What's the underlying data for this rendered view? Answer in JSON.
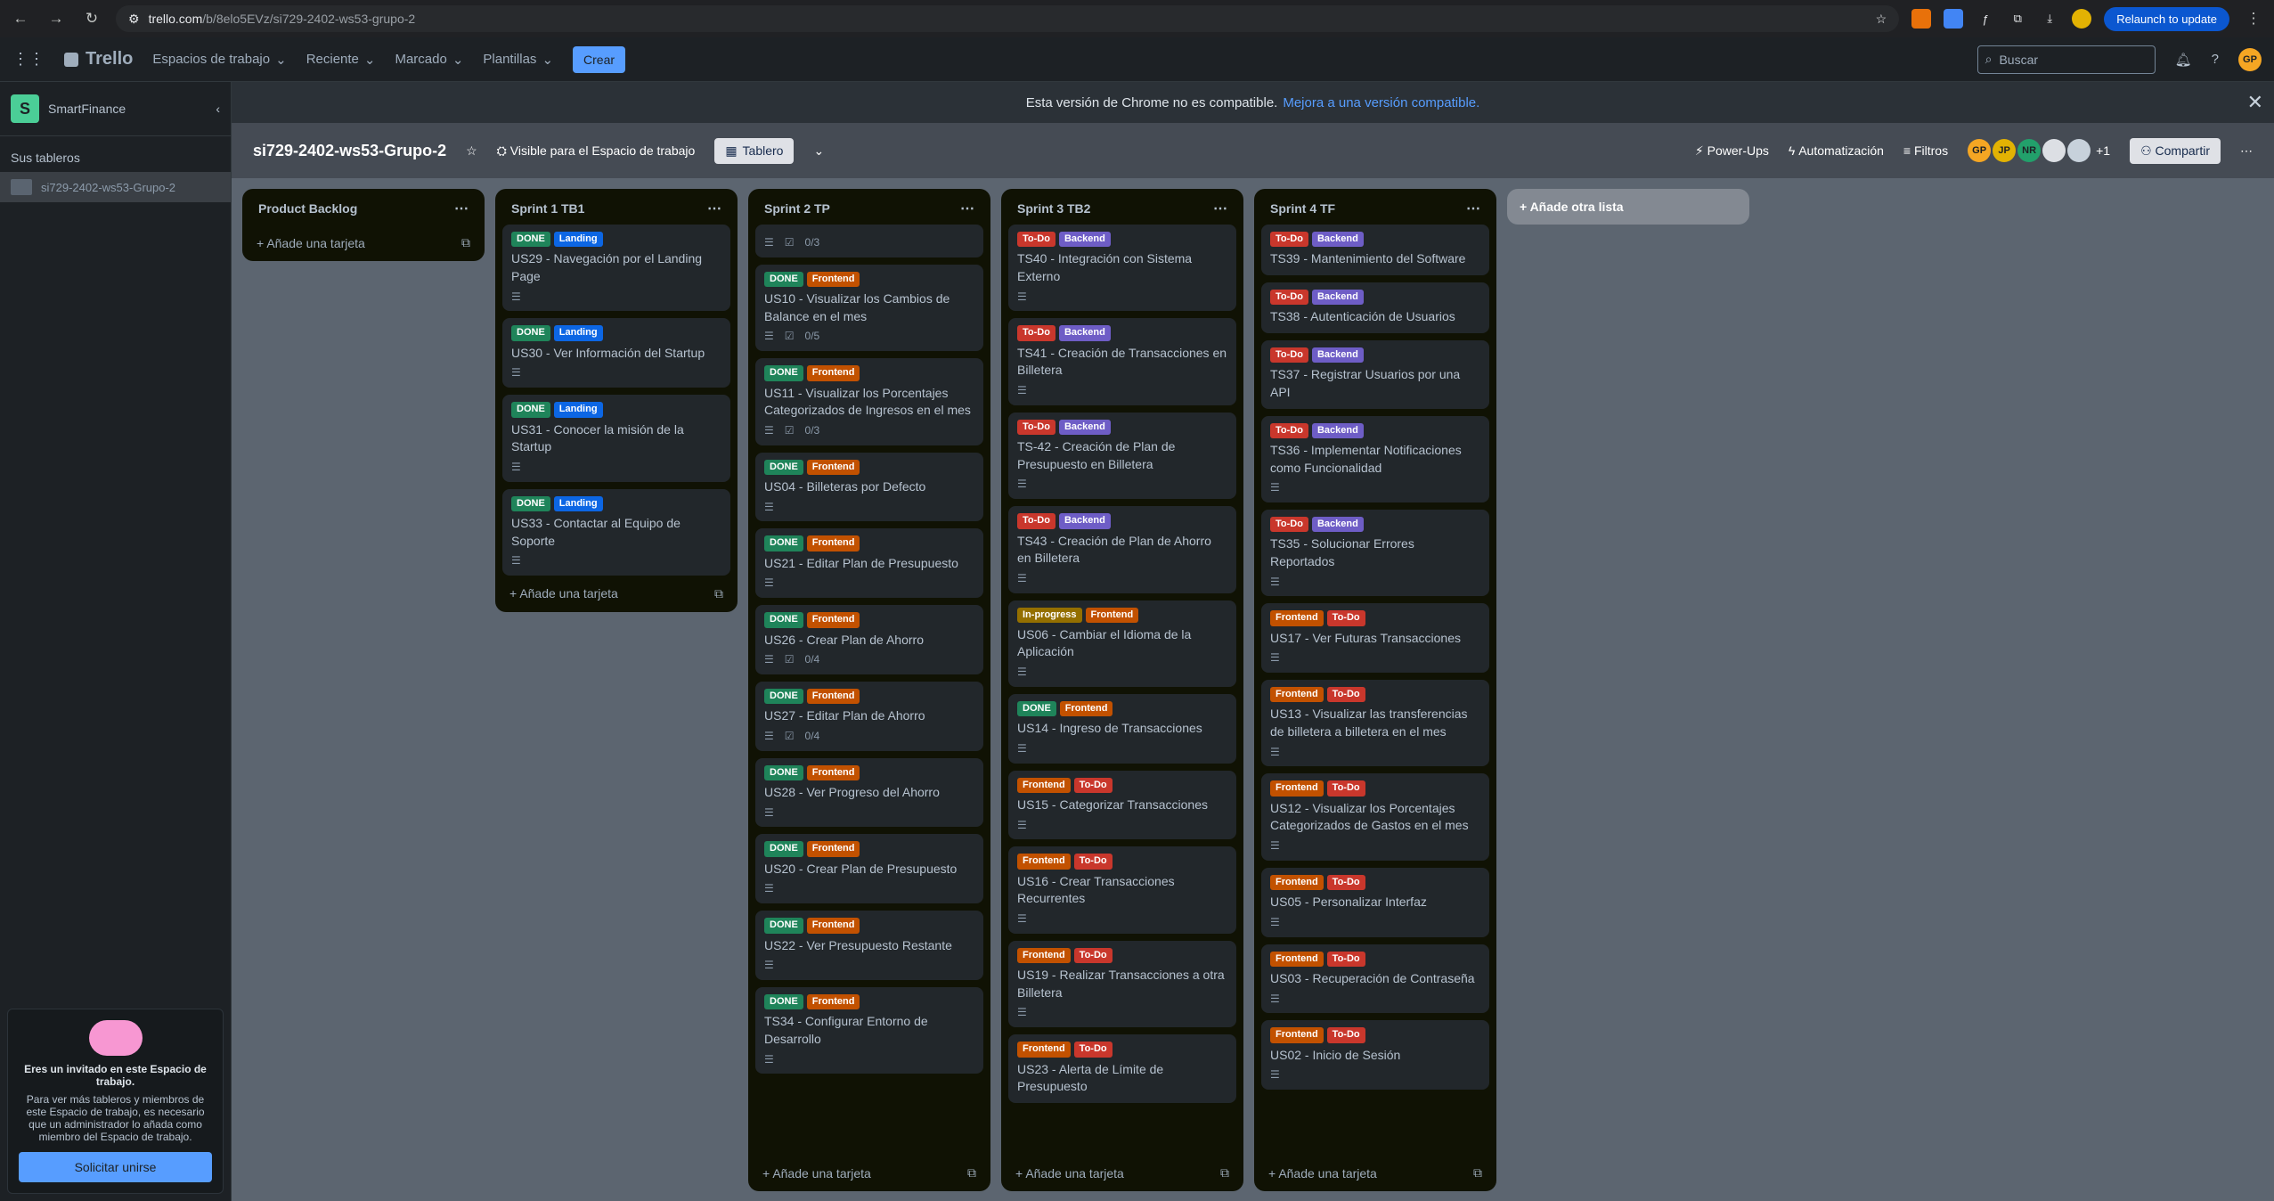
{
  "browser": {
    "url_domain": "trello.com",
    "url_path": "/b/8elo5EVz/si729-2402-ws53-grupo-2",
    "relaunch": "Relaunch to update",
    "avatar": "GP"
  },
  "nav": {
    "brand": "Trello",
    "menus": [
      "Espacios de trabajo",
      "Reciente",
      "Marcado",
      "Plantillas"
    ],
    "create": "Crear",
    "search_placeholder": "Buscar",
    "avatar": "GP"
  },
  "sidebar": {
    "workspace": "SmartFinance",
    "ws_initial": "S",
    "section": "Sus tableros",
    "board": "si729-2402-ws53-Grupo-2",
    "invite": {
      "title": "Eres un invitado en este Espacio de trabajo.",
      "text": "Para ver más tableros y miembros de este Espacio de trabajo, es necesario que un administrador lo añada como miembro del Espacio de trabajo.",
      "button": "Solicitar unirse"
    }
  },
  "banner": {
    "text": "Esta versión de Chrome no es compatible.",
    "link": "Mejora a una versión compatible."
  },
  "board": {
    "title": "si729-2402-ws53-Grupo-2",
    "visibility": "Visible para el Espacio de trabajo",
    "view": "Tablero",
    "powerups": "Power-Ups",
    "automation": "Automatización",
    "filters": "Filtros",
    "members": [
      "GP",
      "JP",
      "NR"
    ],
    "extra_members": "+1",
    "share": "Compartir"
  },
  "colors": {
    "DONE": "#1f845a",
    "Landing": "#0c66e4",
    "Frontend": "#c25100",
    "Backend": "#6e5dc6",
    "To-Do": "#c9372c",
    "In-progress": "#946f00"
  },
  "add_card": "Añade una tarjeta",
  "add_list": "Añade otra lista",
  "lists": [
    {
      "name": "Product Backlog",
      "cards": []
    },
    {
      "name": "Sprint 1 TB1",
      "cards": [
        {
          "labels": [
            "DONE",
            "Landing"
          ],
          "title": "US29 - Navegación por el Landing Page",
          "desc": true
        },
        {
          "labels": [
            "DONE",
            "Landing"
          ],
          "title": "US30 - Ver Información del Startup",
          "desc": true
        },
        {
          "labels": [
            "DONE",
            "Landing"
          ],
          "title": "US31 - Conocer la misión de la Startup",
          "desc": true
        },
        {
          "labels": [
            "DONE",
            "Landing"
          ],
          "title": "US33 - Contactar al Equipo de Soporte",
          "desc": true
        }
      ]
    },
    {
      "name": "Sprint 2 TP",
      "cards": [
        {
          "labels": [],
          "title": "",
          "desc": true,
          "check": "0/3"
        },
        {
          "labels": [
            "DONE",
            "Frontend"
          ],
          "title": "US10 - Visualizar los Cambios de Balance en el mes",
          "desc": true,
          "check": "0/5"
        },
        {
          "labels": [
            "DONE",
            "Frontend"
          ],
          "title": "US11 - Visualizar los Porcentajes Categorizados de Ingresos en el mes",
          "desc": true,
          "check": "0/3"
        },
        {
          "labels": [
            "DONE",
            "Frontend"
          ],
          "title": "US04 - Billeteras por Defecto",
          "desc": true
        },
        {
          "labels": [
            "DONE",
            "Frontend"
          ],
          "title": "US21 - Editar Plan de Presupuesto",
          "desc": true
        },
        {
          "labels": [
            "DONE",
            "Frontend"
          ],
          "title": "US26 - Crear Plan de Ahorro",
          "desc": true,
          "check": "0/4"
        },
        {
          "labels": [
            "DONE",
            "Frontend"
          ],
          "title": "US27 - Editar Plan de Ahorro",
          "desc": true,
          "check": "0/4"
        },
        {
          "labels": [
            "DONE",
            "Frontend"
          ],
          "title": "US28 - Ver Progreso del Ahorro",
          "desc": true
        },
        {
          "labels": [
            "DONE",
            "Frontend"
          ],
          "title": "US20 - Crear Plan de Presupuesto",
          "desc": true
        },
        {
          "labels": [
            "DONE",
            "Frontend"
          ],
          "title": "US22 - Ver Presupuesto Restante",
          "desc": true
        },
        {
          "labels": [
            "DONE",
            "Frontend"
          ],
          "title": "TS34 - Configurar Entorno de Desarrollo",
          "desc": true
        }
      ]
    },
    {
      "name": "Sprint 3 TB2",
      "cards": [
        {
          "labels": [
            "To-Do",
            "Backend"
          ],
          "title": "TS40 - Integración con Sistema Externo",
          "desc": true
        },
        {
          "labels": [
            "To-Do",
            "Backend"
          ],
          "title": "TS41 - Creación de Transacciones en Billetera",
          "desc": true
        },
        {
          "labels": [
            "To-Do",
            "Backend"
          ],
          "title": "TS-42 - Creación de Plan de Presupuesto en Billetera",
          "desc": true
        },
        {
          "labels": [
            "To-Do",
            "Backend"
          ],
          "title": "TS43 - Creación de Plan de Ahorro en Billetera",
          "desc": true
        },
        {
          "labels": [
            "In-progress",
            "Frontend"
          ],
          "title": "US06 - Cambiar el Idioma de la Aplicación",
          "desc": true
        },
        {
          "labels": [
            "DONE",
            "Frontend"
          ],
          "title": "US14 - Ingreso de Transacciones",
          "desc": true
        },
        {
          "labels": [
            "Frontend",
            "To-Do"
          ],
          "title": "US15 - Categorizar Transacciones",
          "desc": true
        },
        {
          "labels": [
            "Frontend",
            "To-Do"
          ],
          "title": "US16 - Crear Transacciones Recurrentes",
          "desc": true
        },
        {
          "labels": [
            "Frontend",
            "To-Do"
          ],
          "title": "US19 - Realizar Transacciones a otra Billetera",
          "desc": true
        },
        {
          "labels": [
            "Frontend",
            "To-Do"
          ],
          "title": "US23 - Alerta de Límite de Presupuesto",
          "desc": false
        }
      ]
    },
    {
      "name": "Sprint 4 TF",
      "cards": [
        {
          "labels": [
            "To-Do",
            "Backend"
          ],
          "title": "TS39 - Mantenimiento del Software",
          "desc": false
        },
        {
          "labels": [
            "To-Do",
            "Backend"
          ],
          "title": "TS38 - Autenticación de Usuarios",
          "desc": false
        },
        {
          "labels": [
            "To-Do",
            "Backend"
          ],
          "title": "TS37 - Registrar Usuarios por una API",
          "desc": false
        },
        {
          "labels": [
            "To-Do",
            "Backend"
          ],
          "title": "TS36 - Implementar Notificaciones como Funcionalidad",
          "desc": true
        },
        {
          "labels": [
            "To-Do",
            "Backend"
          ],
          "title": "TS35 - Solucionar Errores Reportados",
          "desc": true
        },
        {
          "labels": [
            "Frontend",
            "To-Do"
          ],
          "title": "US17 - Ver Futuras Transacciones",
          "desc": true
        },
        {
          "labels": [
            "Frontend",
            "To-Do"
          ],
          "title": "US13 - Visualizar las transferencias de billetera a billetera en el mes",
          "desc": true
        },
        {
          "labels": [
            "Frontend",
            "To-Do"
          ],
          "title": "US12 - Visualizar los Porcentajes Categorizados de Gastos en el mes",
          "desc": true
        },
        {
          "labels": [
            "Frontend",
            "To-Do"
          ],
          "title": "US05 - Personalizar Interfaz",
          "desc": true
        },
        {
          "labels": [
            "Frontend",
            "To-Do"
          ],
          "title": "US03 - Recuperación de Contraseña",
          "desc": true
        },
        {
          "labels": [
            "Frontend",
            "To-Do"
          ],
          "title": "US02 - Inicio de Sesión",
          "desc": true
        }
      ]
    }
  ]
}
